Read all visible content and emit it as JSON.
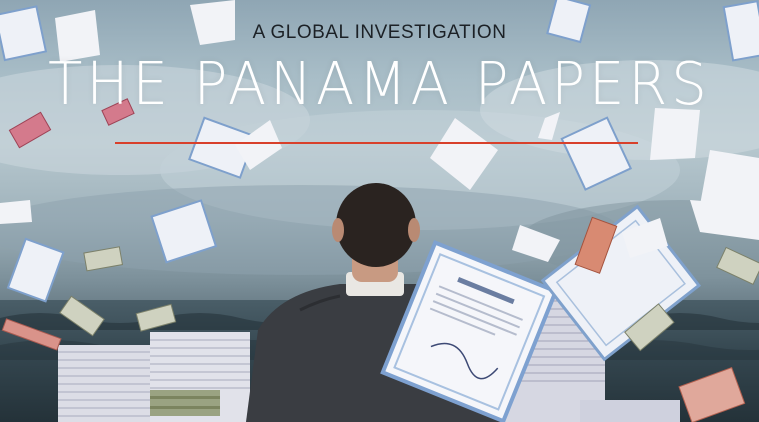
{
  "kicker": "A GLOBAL INVESTIGATION",
  "headline": "THE PANAMA PAPERS",
  "colors": {
    "accent_rule": "#d8402b",
    "headline": "#ffffff",
    "kicker": "#1c2126",
    "sky": "#a8bdc7",
    "sea": "#2f4049",
    "suit": "#3a3d42"
  }
}
